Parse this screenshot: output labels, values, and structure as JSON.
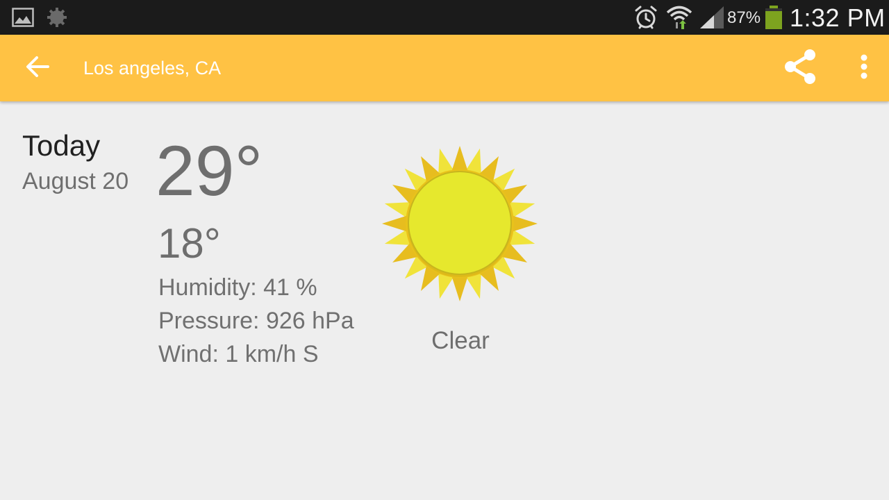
{
  "status_bar": {
    "battery_percent": "87%",
    "time": "1:32 PM",
    "icons": [
      "gallery-icon",
      "settings-icon",
      "alarm-icon",
      "wifi-icon",
      "signal-icon",
      "battery-icon"
    ]
  },
  "action_bar": {
    "title": "Los angeles, CA",
    "background_color": "#ffc244",
    "icons": [
      "back-arrow-icon",
      "share-icon",
      "overflow-menu-icon"
    ]
  },
  "forecast": {
    "day": "Today",
    "date": "August 20",
    "high": "29°",
    "low": "18°",
    "humidity": "Humidity: 41 %",
    "pressure": "Pressure: 926 hPa",
    "wind": "Wind: 1 km/h S",
    "condition": "Clear",
    "icon": "sun-icon"
  }
}
